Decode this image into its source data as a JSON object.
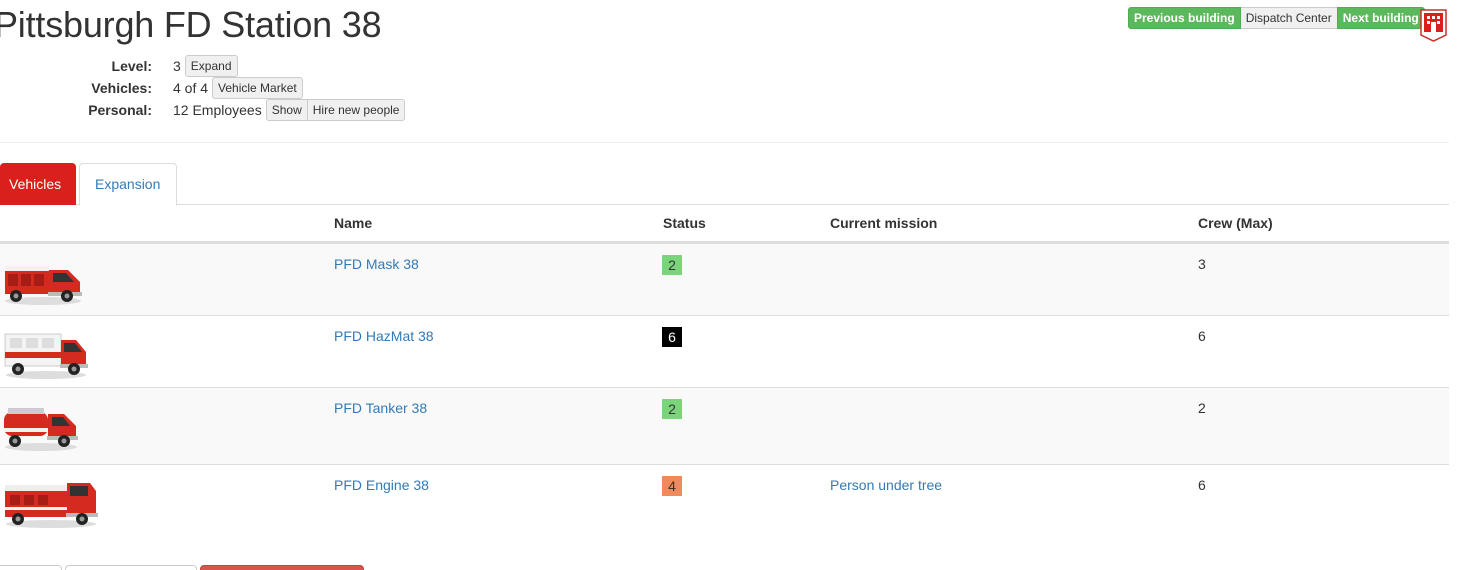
{
  "page": {
    "title": "Pittsburgh FD Station 38"
  },
  "nav": {
    "previous_label": "Previous building",
    "dispatch_label": "Dispatch Center",
    "next_label": "Next building"
  },
  "info": {
    "level_label": "Level:",
    "level_value": "3",
    "expand_label": "Expand",
    "vehicles_label": "Vehicles:",
    "vehicles_value": "4 of 4",
    "vehicle_market_label": "Vehicle Market",
    "personal_label": "Personal:",
    "personal_value": "12 Employees",
    "show_label": "Show",
    "hire_label": "Hire new people"
  },
  "tabs": [
    {
      "label": "Vehicles",
      "active": true
    },
    {
      "label": "Expansion",
      "active": false
    }
  ],
  "table": {
    "headers": [
      "Name",
      "Status",
      "Current mission",
      "Crew (Max)"
    ],
    "rows": [
      {
        "name": "PFD Mask 38",
        "status": "2",
        "status_color": "#7ad47a",
        "mission": "",
        "crew": "3",
        "truck": "rescue-truck"
      },
      {
        "name": "PFD HazMat 38",
        "status": "6",
        "status_color": "#000000",
        "mission": "",
        "crew": "6",
        "truck": "hazmat-truck"
      },
      {
        "name": "PFD Tanker 38",
        "status": "2",
        "status_color": "#7ad47a",
        "mission": "",
        "crew": "2",
        "truck": "tanker-truck"
      },
      {
        "name": "PFD Engine 38",
        "status": "4",
        "status_color": "#f08a5d",
        "mission": "Person under tree",
        "crew": "6",
        "truck": "engine-truck"
      }
    ]
  },
  "colors": {
    "accent_red": "#d9201d",
    "link_blue": "#337ab7",
    "success_green": "#5cb85c"
  }
}
